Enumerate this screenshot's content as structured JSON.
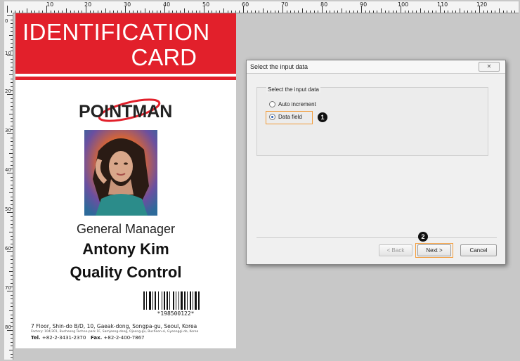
{
  "ruler": {
    "top_labels": [
      "10",
      "20",
      "30",
      "40",
      "50",
      "60",
      "70",
      "80",
      "90",
      "100",
      "110",
      "120"
    ],
    "left_labels": [
      "0",
      "10",
      "20",
      "30",
      "40",
      "50",
      "60",
      "70",
      "80"
    ]
  },
  "card": {
    "title_line1": "IDENTIFICATION",
    "title_line2": "CARD",
    "logo": "POINTMAN",
    "job_title": "General Manager",
    "name": "Antony Kim",
    "department": "Quality Control",
    "barcode_number": "*198500122*",
    "address_line1": "7 Floor, Shin-do B/D, 10, Gaeak-dong, Songpa-gu, Seoul, Korea",
    "address_line2": "Factory: 104/301, Bucheong Techno-park 1F, Samjeong-dong, Ojeong-gu, Bucheon-si, Gyeonggi-do, Korea",
    "tel_label": "Tel.",
    "tel_value": "+82-2-3431-2370",
    "fax_label": "Fax.",
    "fax_value": "+82-2-400-7867",
    "brand_color": "#e2202b"
  },
  "dialog": {
    "title": "Select the input data",
    "close_glyph": "✕",
    "group_label": "Select the input data",
    "options": [
      {
        "label": "Auto increment",
        "selected": false
      },
      {
        "label": "Data field",
        "selected": true
      }
    ],
    "step1_marker": "1",
    "step2_marker": "2",
    "back_label": "< Back",
    "next_label": "Next >",
    "cancel_label": "Cancel",
    "highlight_color": "#f29b38"
  }
}
